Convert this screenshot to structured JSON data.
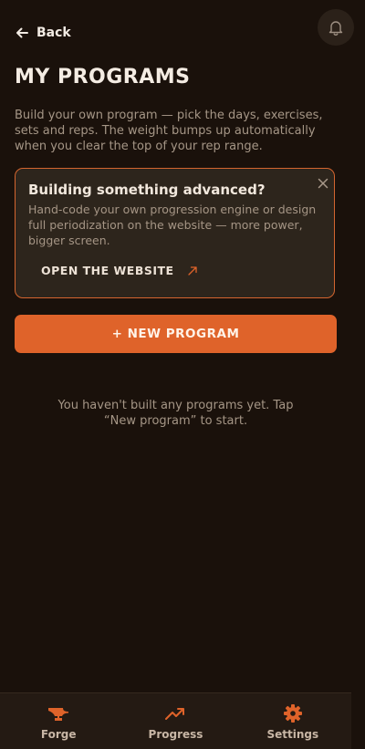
{
  "header": {
    "back_label": "Back"
  },
  "page": {
    "title": "MY PROGRAMS",
    "intro": "Build your own program — pick the days, exercises, sets and reps. The weight bumps up automatically when you clear the top of your rep range."
  },
  "promo": {
    "title": "Building something advanced?",
    "text": "Hand-code your own progression engine or design full periodization on the website — more power, bigger screen.",
    "link_label": "OPEN THE WEBSITE"
  },
  "actions": {
    "new_program_label": "+ NEW PROGRAM"
  },
  "empty_state": {
    "text": "You haven't built any programs yet. Tap “New program” to start."
  },
  "tabbar": {
    "items": [
      {
        "label": "Forge",
        "icon": "anvil-icon"
      },
      {
        "label": "Progress",
        "icon": "trend-up-icon"
      },
      {
        "label": "Settings",
        "icon": "gear-icon"
      }
    ]
  },
  "colors": {
    "background": "#1a110b",
    "accent": "#df632a",
    "card": "#2d251c",
    "muted_text": "#a59686"
  }
}
